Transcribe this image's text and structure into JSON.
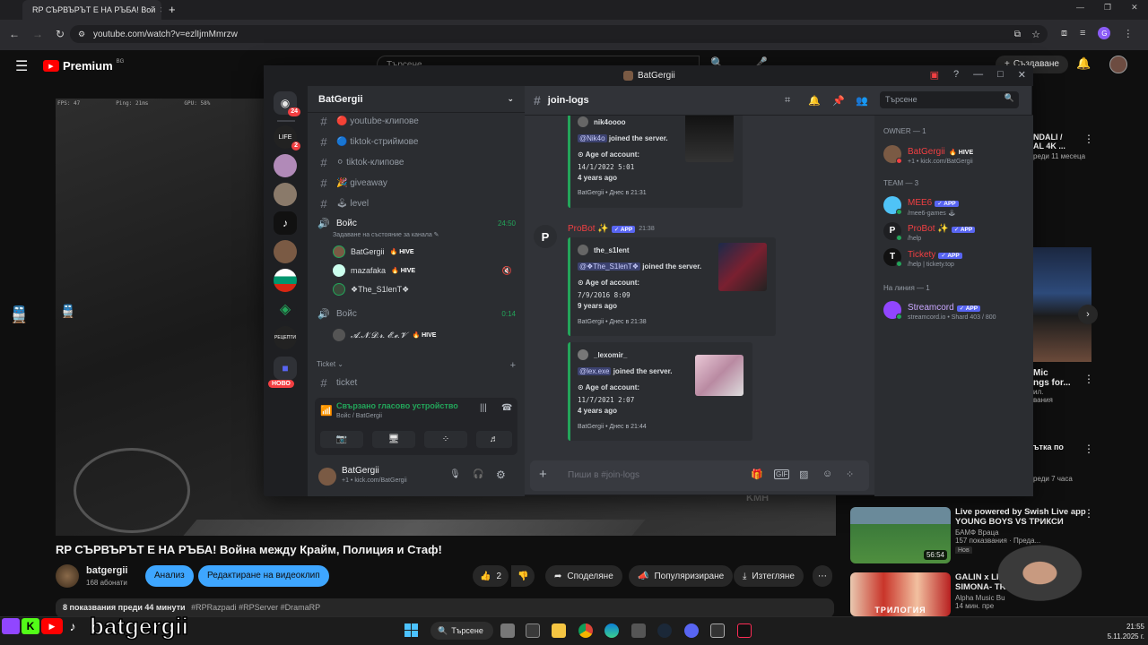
{
  "browser": {
    "tab_title": "RP СЪРВЪРЪТ Е НА РЪБА! Вой",
    "url": "youtube.com/watch?v=ezlIjmMmrzw"
  },
  "youtube": {
    "logo": "Premium",
    "region": "BG",
    "search_placeholder": "Търсене",
    "create_label": "Създаване",
    "video_title": "RP СЪРВЪРЪТ Е НА РЪБА! Война между Крайм, Полиция и Стаф!",
    "channel_name": "batgergii",
    "subscribers": "168 абонати",
    "analysis_label": "Анализ",
    "edit_label": "Редактиране на видеоклип",
    "likes": "2",
    "share_label": "Споделяне",
    "promote_label": "Популяризиране",
    "download_label": "Изтегляне",
    "desc_line": "8 показвания  преди 44 минути",
    "hashtags": "#RPRazpadi #RPServer #DramaRP",
    "overlay_stats": {
      "fps": "FPS: 47",
      "ping": "Ping: 21ms",
      "gpu": "GPU: 58%"
    },
    "speed_unit": "KMH",
    "sidebar": [
      {
        "title": "NDALI /",
        "line2": "AL 4K ...",
        "meta": "реди 11 месеца"
      },
      {
        "title": "Mic",
        "line2": "ngs for...",
        "meta": "ил.",
        "meta2": "вания"
      },
      {
        "title": "ъткa по",
        "meta": "реди 7 часа"
      },
      {
        "title": "Live powered by Swish Live app",
        "line2": "YOUNG BOYS VS ТРИКСИ",
        "meta": "БАМФ Враца",
        "meta2": "157 показвания · Преда...",
        "badge": "Нов",
        "duration": "56:54"
      },
      {
        "title": "GALIN x LIDIA x IV",
        "line2": "SIMONA- TRIL",
        "meta": "Alpha Music Bu",
        "meta2": "14 мин. пре",
        "thumb_text": "ТРИЛОГИЯ"
      }
    ],
    "streamer_name": "batgergii"
  },
  "discord": {
    "window_title": "BatGergii",
    "server_name": "BatGergii",
    "channel_name": "join-logs",
    "search_placeholder": "Търсене",
    "guild_badges": {
      "home": "24",
      "life": "2"
    },
    "new_label": "НОВО",
    "channels": [
      {
        "label": "🔴 youtube-клипове"
      },
      {
        "label": "🔵 tiktok-стриймове"
      },
      {
        "label": "⚪ tiktok-клипове"
      },
      {
        "label": "🎉 giveaway"
      },
      {
        "label": "🕹 level"
      }
    ],
    "voice1": {
      "name": "Войс",
      "timer": "24:50",
      "status": "Задаване на състояние за канала ✎",
      "users": [
        {
          "name": "BatGergii",
          "tag": "🔥 HIVE"
        },
        {
          "name": "mazafaka",
          "tag": "🔥 HIVE"
        },
        {
          "name": "❖The_S1lenT❖",
          "tag": ""
        }
      ]
    },
    "voice2": {
      "name": "Войс",
      "timer": "0:14",
      "users": [
        {
          "name": "𝓐.𝓝.𝓓.𝓻. 𝓔.𝓮.𝓥",
          "tag": "🔥 HIVE"
        }
      ]
    },
    "ticket_category": "Ticket",
    "ticket_channel": "ticket",
    "voice_connected": "Свързано гласово устройство",
    "voice_connected_sub": "Войс / BatGergii",
    "user_panel": {
      "name": "BatGergii",
      "status": "+1 • kick.com/BatGergii"
    },
    "messages": [
      {
        "user": "nik4oooo",
        "mention": "@Nik4o",
        "joined": "joined the server.",
        "age_label": "Age of account:",
        "date": "14/1/2022 5:01",
        "years": "4 years ago",
        "footer": "BatGergii • Днес в 21:31"
      },
      {
        "user": "the_s1lent",
        "mention": "@❖The_S1lenT❖",
        "joined": "joined the server.",
        "age_label": "Age of account:",
        "date": "7/9/2016 8:09",
        "years": "9 years ago",
        "footer": "BatGergii • Днес в 21:38"
      },
      {
        "user": "_lexomir_",
        "mention": "@lex.exe",
        "joined": "joined the server.",
        "age_label": "Age of account:",
        "date": "11/7/2021 2:07",
        "years": "4 years ago",
        "footer": "BatGergii • Днес в 21:44"
      }
    ],
    "probot": {
      "name": "ProBot ✨",
      "app": "✓ APP",
      "time": "21:38"
    },
    "composer_placeholder": "Пиши в #join-logs",
    "members": {
      "owner_header": "OWNER — 1",
      "owner": {
        "name": "BatGergii",
        "tag": "🔥 HIVE",
        "sub": "+1 • kick.com/BatGergii"
      },
      "team_header": "TEAM — 3",
      "team": [
        {
          "name": "MEE6",
          "sub": "/mee6-games 🕹"
        },
        {
          "name": "ProBot ✨",
          "sub": "/help"
        },
        {
          "name": "Tickety",
          "sub": "/help | tickety.top"
        }
      ],
      "online_header": "На линия — 1",
      "online": [
        {
          "name": "Streamcord",
          "sub": "streamcord.io • Shard 403 / 800"
        }
      ],
      "app_label": "✓ APP"
    }
  },
  "taskbar": {
    "search_label": "Търсене",
    "time": "21:55",
    "date": "5.11.2025 г."
  },
  "colors": {
    "accent_blue": "#3ea6ff",
    "discord_green": "#23a55a",
    "discord_blurple": "#5865f2",
    "probot_red": "#f23f42"
  }
}
